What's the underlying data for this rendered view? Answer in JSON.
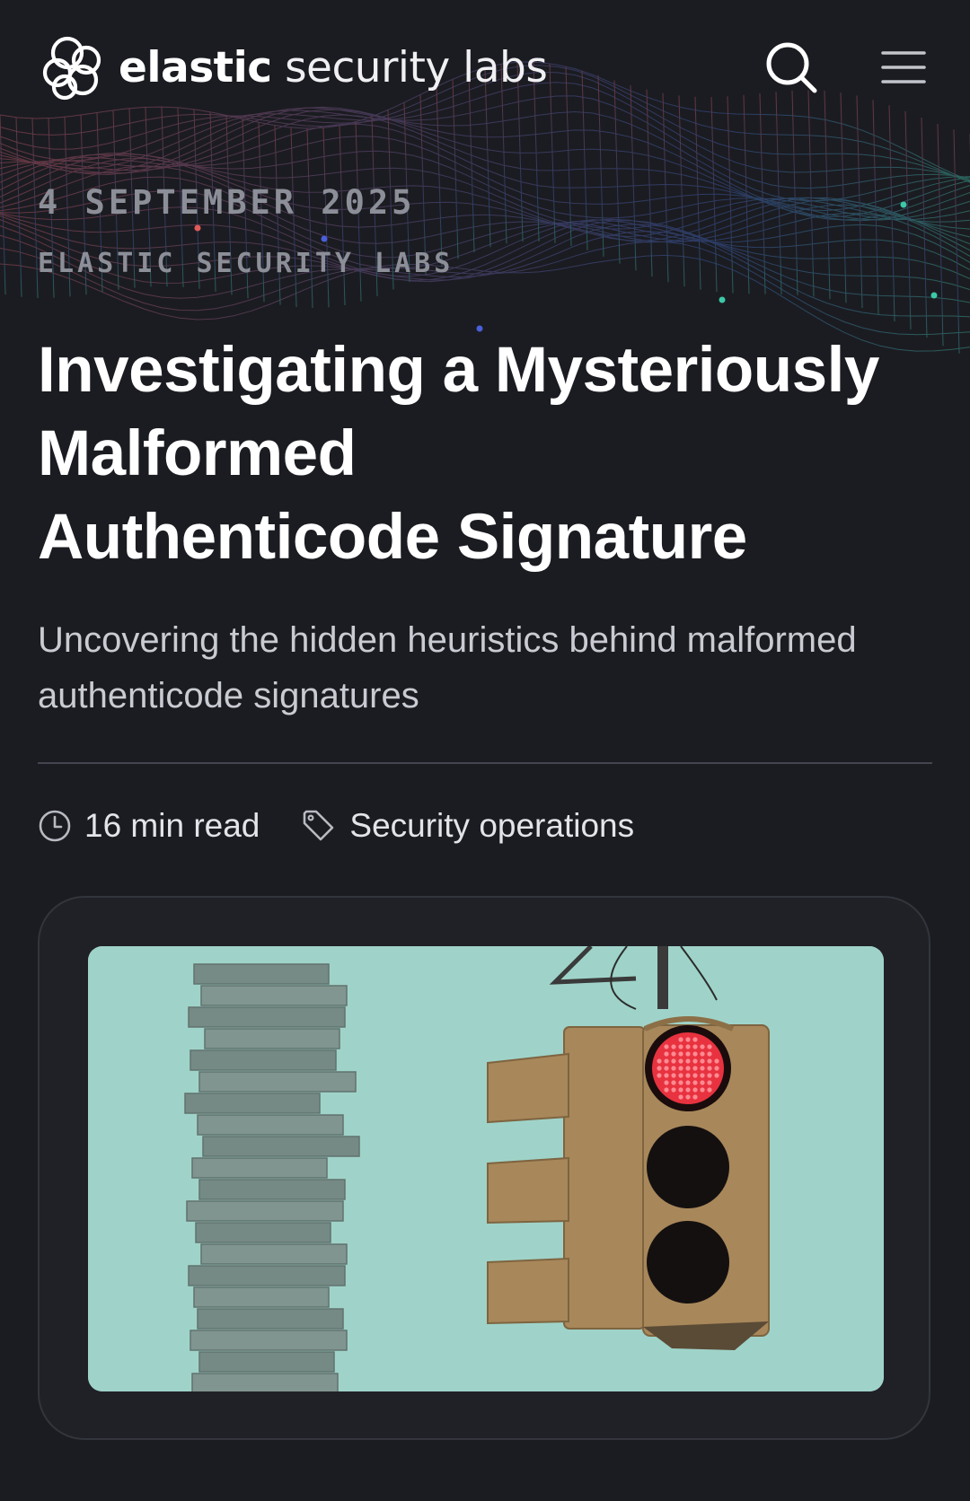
{
  "header": {
    "logo_bold": "elastic",
    "logo_light": " security labs",
    "logo_icon": "elastic-cluster-logo",
    "search_icon": "search-icon",
    "menu_icon": "hamburger-menu-icon"
  },
  "article": {
    "date": "4 SEPTEMBER 2025",
    "author": "ELASTIC SECURITY LABS",
    "title_lines": [
      "Investigating a Mysteriously",
      "Malformed",
      "Authenticode Signature"
    ],
    "subtitle_lines": [
      "Uncovering the hidden heuristics behind malformed",
      "authenticode signatures"
    ],
    "read_time": "16 min read",
    "read_time_icon": "clock-icon",
    "category": "Security operations",
    "category_icon": "tag-icon",
    "hero_image": "illustration-stacked-tower-and-red-traffic-light"
  },
  "colors": {
    "background": "#1b1c21",
    "card_background": "#202127",
    "image_background": "#9fd3c9",
    "muted_text": "#8c8f98",
    "subtitle_text": "#c9cbd2",
    "traffic_light_red": "#e8323f",
    "traffic_light_body": "#a8875a"
  }
}
